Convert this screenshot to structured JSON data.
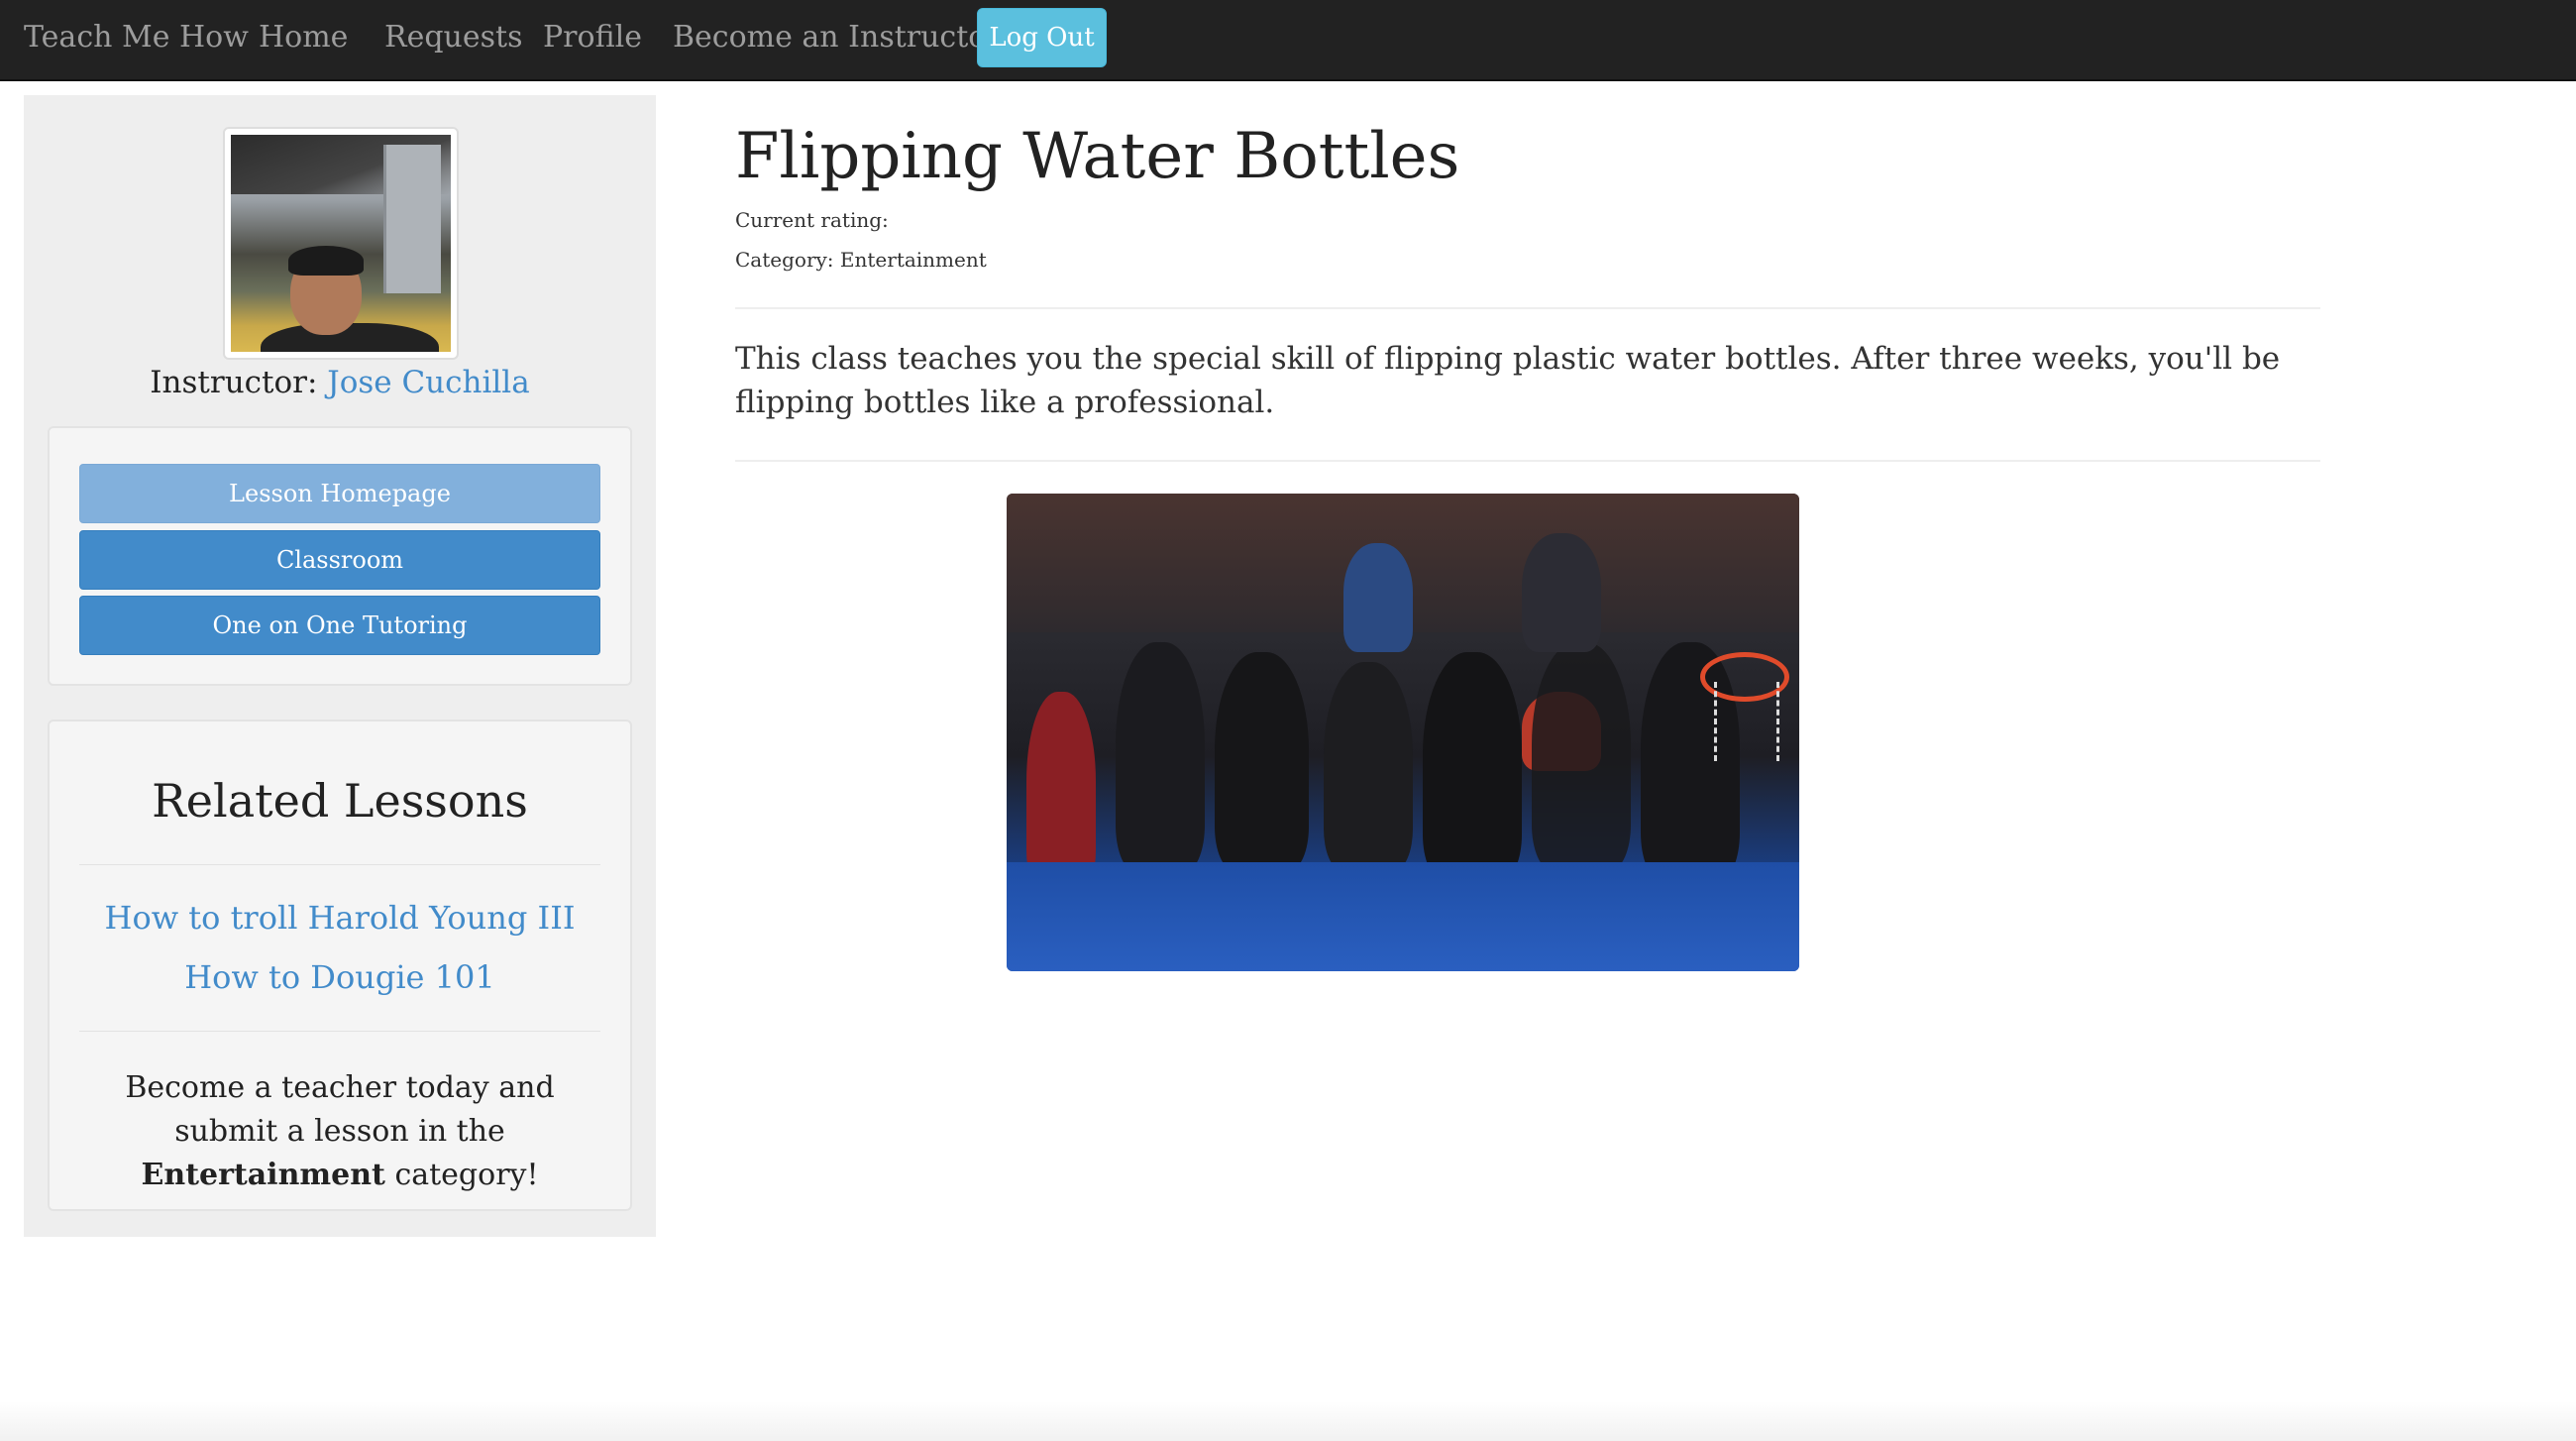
{
  "navbar": {
    "brand": "Teach Me How",
    "links": [
      "Home",
      "Requests",
      "Profile",
      "Become an Instructor!"
    ],
    "logout_label": "Log Out"
  },
  "sidebar": {
    "instructor_prefix": "Instructor:",
    "instructor_name": "Jose Cuchilla",
    "buttons": [
      "Lesson Homepage",
      "Classroom",
      "One on One Tutoring"
    ],
    "related_title": "Related Lessons",
    "related_links": [
      "How to troll Harold Young III",
      "How to Dougie 101"
    ],
    "cta_before": "Become a teacher today and submit a lesson in the",
    "cta_category": "Entertainment",
    "cta_after": "category!"
  },
  "lesson": {
    "title": "Flipping Water Bottles",
    "rating_label": "Current rating:",
    "category_label": "Category: Entertainment",
    "description": "This class teaches you the special skill of flipping plastic water bottles. After three weeks, you'll be flipping bottles like a professional."
  },
  "colors": {
    "navbar": "#222222",
    "link": "#428bca",
    "button": "#428bca",
    "logout": "#5bc0de"
  }
}
